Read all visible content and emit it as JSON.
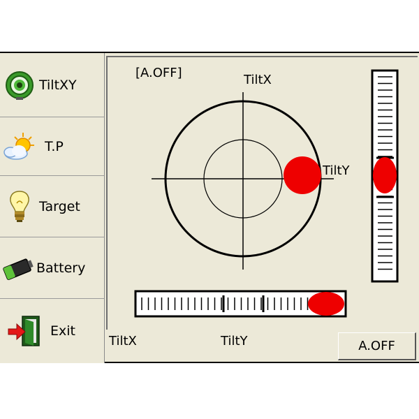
{
  "sidebar": {
    "items": [
      {
        "label": "TiltXY",
        "icon": "target-rings-icon"
      },
      {
        "label": "T.P",
        "icon": "sun-cloud-icon"
      },
      {
        "label": "Target",
        "icon": "lightbulb-icon"
      },
      {
        "label": "Battery",
        "icon": "battery-icon"
      },
      {
        "label": "Exit",
        "icon": "exit-door-icon"
      }
    ]
  },
  "main": {
    "mode_indicator": "[A.OFF]",
    "tilt_x_label": "TiltX",
    "tilt_y_label": "TiltY"
  },
  "status": {
    "tilt_x_label": "TiltX",
    "tilt_y_label": "TiltY",
    "auto_off_button": "A.OFF"
  },
  "colors": {
    "background": "#ece9d8",
    "bubble": "#ee0000"
  }
}
